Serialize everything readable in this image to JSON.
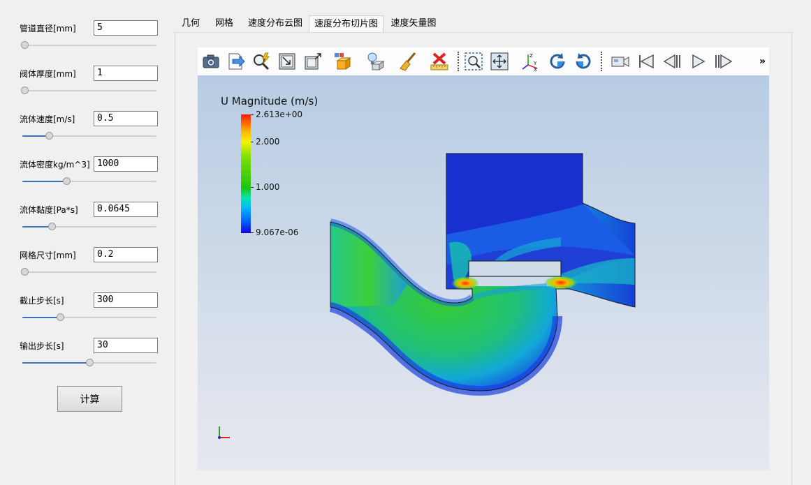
{
  "params": [
    {
      "label": "管道直径[mm]",
      "value": "5",
      "slider": 0.0
    },
    {
      "label": "阀体厚度[mm]",
      "value": "1",
      "slider": 0.0
    },
    {
      "label": "流体速度[m/s]",
      "value": "0.5",
      "slider": 0.2
    },
    {
      "label": "流体密度kg/m^3]",
      "value": "1000",
      "slider": 0.33
    },
    {
      "label": "流体黏度[Pa*s]",
      "value": "0.0645",
      "slider": 0.22
    },
    {
      "label": "网格尺寸[mm]",
      "value": "0.2",
      "slider": 0.0
    },
    {
      "label": "截止步长[s]",
      "value": "300",
      "slider": 0.28
    },
    {
      "label": "输出步长[s]",
      "value": "30",
      "slider": 0.5
    }
  ],
  "calc_button": "计算",
  "tabs": [
    "几何",
    "网格",
    "速度分布云图",
    "速度分布切片图",
    "速度矢量图"
  ],
  "active_tab": 3,
  "toolbar": {
    "icons": [
      "camera-icon",
      "export-icon",
      "query-icon",
      "reset-view-icon",
      "zoom-to-box-icon",
      "block-select-icon",
      "light-icon",
      "clear-icon",
      "delete-icon",
      "ruler-icon",
      "zoom-region-icon",
      "fit-all-icon",
      "axes-icon",
      "rotate-cw-icon",
      "rotate-ccw-icon",
      "camera-record-icon",
      "first-frame-icon",
      "prev-frame-icon",
      "play-icon",
      "last-frame-icon"
    ],
    "more": "»"
  },
  "colorbar": {
    "title": "U Magnitude (m/s)",
    "max_label": "2.613e+00",
    "mid_high_label": "2.000",
    "mid_label": "1.000",
    "min_label": "9.067e-06",
    "min": 9.067e-06,
    "max": 2.613
  },
  "colors": {
    "accent": "#3c70b8",
    "field_high": "#ff1a00",
    "field_mid": "#1ec40f",
    "field_low": "#1a00e0"
  }
}
